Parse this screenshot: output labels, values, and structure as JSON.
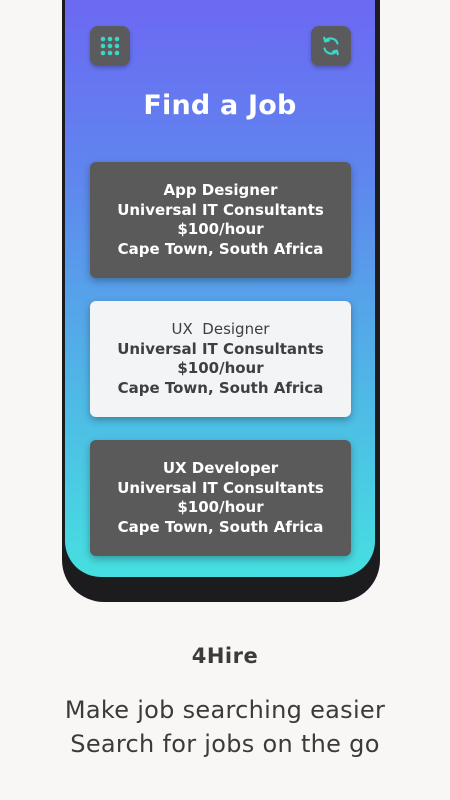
{
  "screen": {
    "title": "Find a Job",
    "menu_icon": "grid-menu-icon",
    "refresh_icon": "refresh-icon",
    "accent_color": "#3ad6c8",
    "gradient_top": "#6f62f4",
    "gradient_bottom": "#46dfe0"
  },
  "jobs": [
    {
      "title": "App Designer",
      "company": "Universal IT Consultants",
      "rate": "$100/hour",
      "location": "Cape Town, South Africa",
      "selected": false
    },
    {
      "title": "UX  Designer",
      "company": "Universal IT Consultants",
      "rate": "$100/hour",
      "location": "Cape Town, South Africa",
      "selected": true
    },
    {
      "title": "UX Developer",
      "company": "Universal IT Consultants",
      "rate": "$100/hour",
      "location": "Cape Town, South Africa",
      "selected": false
    }
  ],
  "promo": {
    "app_name": "4Hire",
    "tagline_1": "Make job searching easier",
    "tagline_2": "Search for jobs on the go"
  }
}
